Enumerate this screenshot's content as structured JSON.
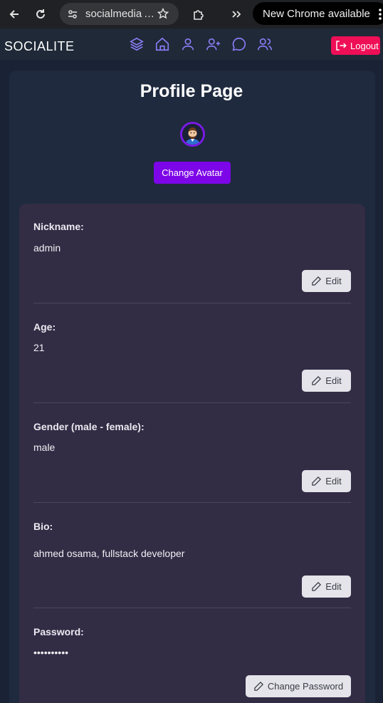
{
  "browser": {
    "url": "socialmedia",
    "update_text": "New Chrome available"
  },
  "nav": {
    "brand": "SOCIALITE",
    "logout_label": "Logout"
  },
  "page": {
    "title": "Profile Page",
    "change_avatar_label": "Change Avatar"
  },
  "fields": [
    {
      "label": "Nickname:",
      "value": "admin",
      "button": "Edit"
    },
    {
      "label": "Age:",
      "value": "21",
      "button": "Edit"
    },
    {
      "label": "Gender (male - female):",
      "value": "male",
      "button": "Edit"
    },
    {
      "label": "Bio:",
      "value": "ahmed osama, fullstack developer",
      "button": "Edit"
    },
    {
      "label": "Password:",
      "value": "••••••••••",
      "button": "Change Password"
    }
  ],
  "colors": {
    "accent": "#7d06e8",
    "logout": "#ef0f57",
    "nav_icon": "#8b7cf6"
  }
}
